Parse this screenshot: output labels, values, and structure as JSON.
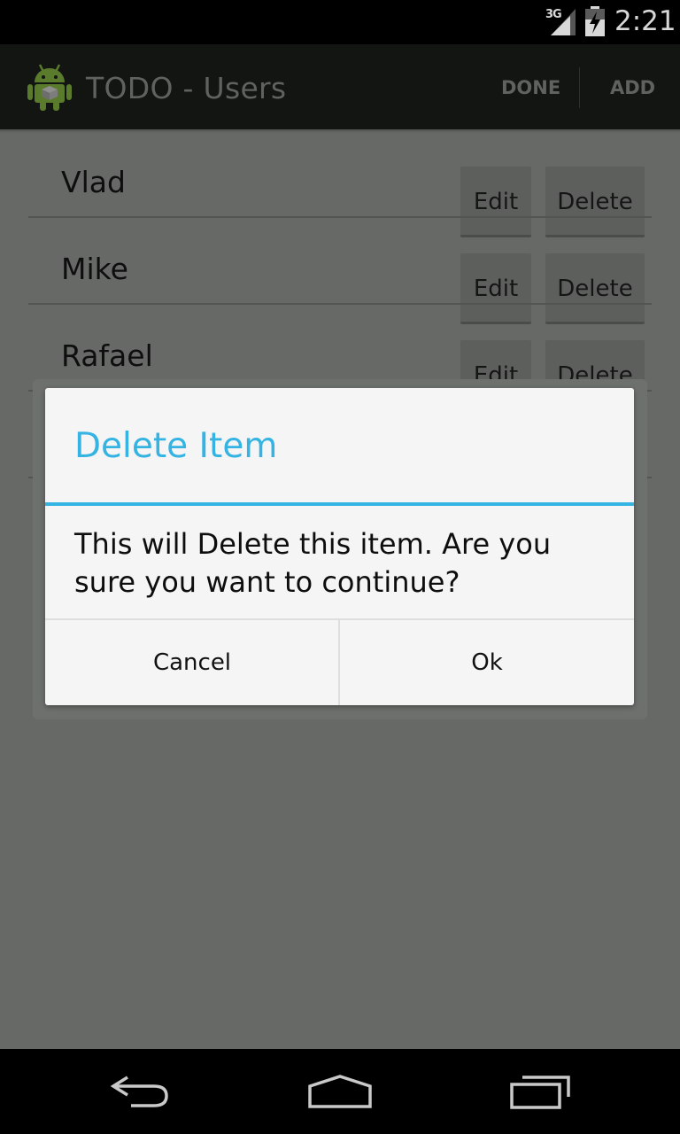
{
  "status_bar": {
    "network": "3G",
    "time": "2:21",
    "icons": [
      "signal-icon",
      "battery-charging-icon"
    ]
  },
  "action_bar": {
    "app_icon": "android-icon",
    "title": "TODO - Users",
    "actions": [
      "DONE",
      "ADD"
    ]
  },
  "users": [
    {
      "name": "Vlad",
      "edit_label": "Edit",
      "delete_label": "Delete"
    },
    {
      "name": "Mike",
      "edit_label": "Edit",
      "delete_label": "Delete"
    },
    {
      "name": "Rafael",
      "edit_label": "Edit",
      "delete_label": "Delete"
    },
    {
      "name": "",
      "edit_label": "",
      "delete_label": ""
    }
  ],
  "dialog": {
    "title": "Delete Item",
    "message": "This will Delete this item. Are you sure you want to continue?",
    "cancel_label": "Cancel",
    "ok_label": "Ok"
  },
  "nav_bar": {
    "icons": [
      "back-icon",
      "home-icon",
      "recents-icon"
    ]
  },
  "colors": {
    "accent": "#35b3e2",
    "scrim_background": "#676967",
    "action_bar": "#121512"
  }
}
